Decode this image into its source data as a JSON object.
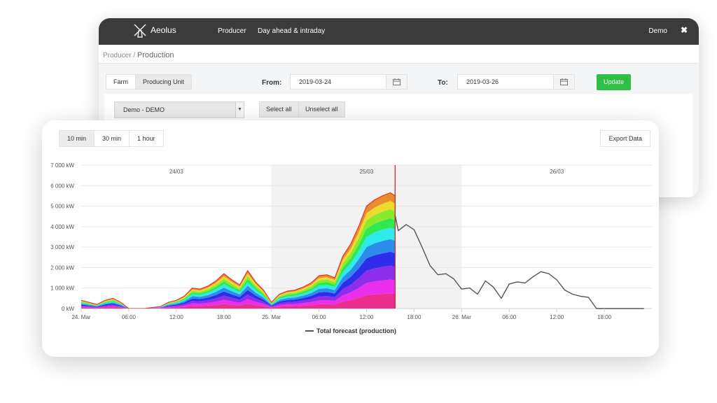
{
  "app": {
    "name": "Aeolus"
  },
  "nav": {
    "items": [
      "Producer",
      "Day ahead & intraday"
    ],
    "user": "Demo",
    "close_glyph": "✖"
  },
  "breadcrumb": {
    "parent": "Producer",
    "separator": "/",
    "current": "Production"
  },
  "filters": {
    "view_tabs": [
      {
        "label": "Farm",
        "active": false
      },
      {
        "label": "Producing Unit",
        "active": true
      }
    ],
    "from_label": "From:",
    "from_value": "2019-03-24",
    "to_label": "To:",
    "to_value": "2019-03-26",
    "update_label": "Update",
    "unit_select": "Demo - DEMO",
    "select_all_label": "Select all",
    "unselect_all_label": "Unselect all"
  },
  "resolution": {
    "tabs": [
      {
        "label": "10 min",
        "active": true
      },
      {
        "label": "30 min",
        "active": false
      },
      {
        "label": "1 hour",
        "active": false
      }
    ]
  },
  "export_label": "Export Data",
  "icons": {
    "logo": "windmill-icon",
    "calendar": "calendar-icon",
    "dropdown": "chevron-down-icon",
    "close": "close-icon"
  },
  "colors": {
    "nav_bg": "#3b3b3b",
    "update_green": "#2fbf45",
    "forecast_line": "#555555",
    "now_marker": "#b22222",
    "shaded_day": "#f2f2f3"
  },
  "chart_data": {
    "type": "area",
    "ylim": [
      0,
      7000
    ],
    "y_ticks": [
      "0 kW",
      "1 000 kW",
      "2 000 kW",
      "3 000 kW",
      "4 000 kW",
      "5 000 kW",
      "6 000 kW",
      "7 000 kW"
    ],
    "x_ticks": [
      "24. Mar",
      "06:00",
      "12:00",
      "18:00",
      "25. Mar",
      "06:00",
      "12:00",
      "18:00",
      "26. Mar",
      "06:00",
      "12:00",
      "18:00"
    ],
    "x_tick_hours": [
      0,
      6,
      12,
      18,
      24,
      30,
      36,
      42,
      48,
      54,
      60,
      66
    ],
    "x_range_hours": [
      0,
      72
    ],
    "day_labels": [
      {
        "label": "24/03",
        "center_hour": 12
      },
      {
        "label": "25/03",
        "center_hour": 36
      },
      {
        "label": "26/03",
        "center_hour": 60
      }
    ],
    "shaded_range_hours": [
      24,
      48
    ],
    "now_hour": 39.6,
    "legend": [
      {
        "name": "Total forecast (production)"
      }
    ],
    "production": {
      "hours": [
        0,
        1,
        2,
        3,
        4,
        5,
        6,
        7,
        8,
        9,
        10,
        11,
        12,
        13,
        14,
        15,
        16,
        17,
        18,
        19,
        20,
        21,
        22,
        23,
        24,
        25,
        26,
        27,
        28,
        29,
        30,
        31,
        32,
        33,
        34,
        35,
        36,
        37,
        38,
        39,
        39.6
      ],
      "total": [
        400,
        300,
        200,
        400,
        500,
        300,
        0,
        0,
        0,
        50,
        100,
        300,
        400,
        600,
        1000,
        950,
        1100,
        1350,
        1700,
        1400,
        1150,
        1850,
        1300,
        900,
        300,
        700,
        850,
        900,
        1050,
        1250,
        1600,
        1650,
        1500,
        2550,
        3150,
        4000,
        5000,
        5300,
        5500,
        5650,
        5500
      ],
      "layer_shares": [
        0.13,
        0.12,
        0.12,
        0.12,
        0.11,
        0.1,
        0.08,
        0.08,
        0.07,
        0.07
      ]
    },
    "forecast": {
      "hours": [
        39.6,
        40,
        41,
        42,
        43,
        44,
        45,
        46,
        47,
        48,
        49,
        50,
        51,
        52,
        53,
        54,
        55,
        56,
        57,
        58,
        59,
        60,
        61,
        62,
        63,
        64,
        65,
        66,
        67,
        68,
        69,
        70,
        71
      ],
      "values": [
        4550,
        3800,
        4100,
        3850,
        3000,
        2100,
        1650,
        1700,
        1450,
        950,
        1000,
        700,
        1350,
        1050,
        500,
        1200,
        1300,
        1250,
        1550,
        1800,
        1700,
        1400,
        900,
        700,
        600,
        550,
        0,
        0,
        0,
        0,
        0,
        0,
        0
      ]
    }
  }
}
